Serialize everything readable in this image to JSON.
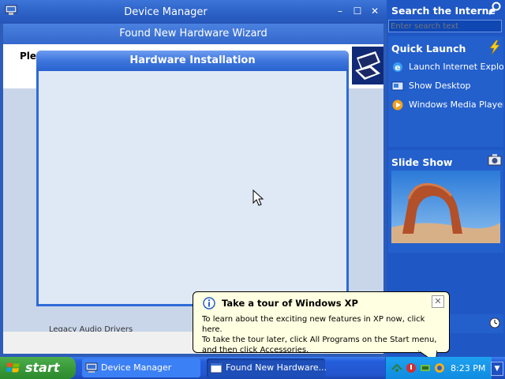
{
  "device_manager": {
    "title": "Device Manager",
    "minimize_glyph": "–",
    "maximize_glyph": "☐",
    "close_glyph": "✕",
    "hidden_list_text": "Legacy Audio Drivers"
  },
  "wizard": {
    "title": "Found New Hardware Wizard",
    "header_text": "Plea"
  },
  "hardware_installation": {
    "title": "Hardware Installation"
  },
  "sidebar": {
    "search": {
      "title": "Search the Interne",
      "placeholder": "Enter search text"
    },
    "quick_launch": {
      "title": "Quick Launch",
      "items": [
        {
          "label": "Launch Internet Explore",
          "icon": "ie-icon"
        },
        {
          "label": "Show Desktop",
          "icon": "show-desktop-icon"
        },
        {
          "label": "Windows Media Player",
          "icon": "media-player-icon"
        }
      ]
    },
    "slide_show": {
      "title": "Slide Show"
    }
  },
  "balloon": {
    "title": "Take a tour of Windows XP",
    "lines": [
      "To learn about the exciting new features in XP now, click here.",
      "To take the tour later, click All Programs on the Start menu,",
      "and then click Accessories."
    ],
    "close_glyph": "✕"
  },
  "taskbar": {
    "start_label": "start",
    "tasks": [
      {
        "label": "Device Manager",
        "icon": "computer-icon"
      },
      {
        "label": "Found New Hardware...",
        "icon": "window-icon"
      }
    ],
    "clock": "8:23 PM",
    "expand_glyph": "▼"
  },
  "colors": {
    "taskbar_blue": "#245edb",
    "start_green": "#3a9a3a",
    "sidebar_blue": "#1f58c4",
    "balloon_bg": "#ffffe1"
  }
}
